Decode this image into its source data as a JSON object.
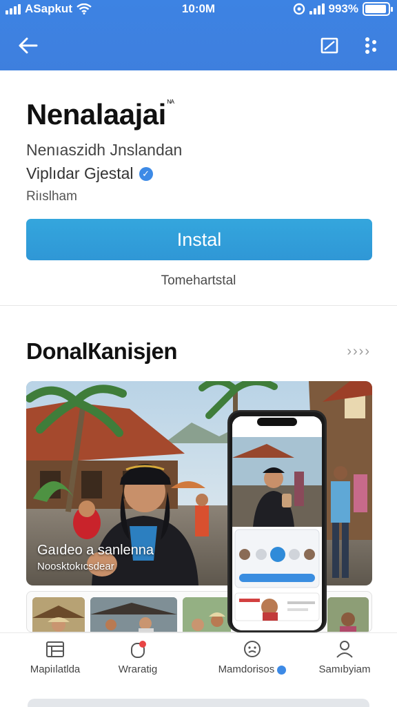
{
  "status_bar": {
    "carrier": "ASapkut",
    "time": "10:0M",
    "battery_text": "993%",
    "battery_level": 0.93
  },
  "app_bar": {
    "back_icon": "back-arrow-icon",
    "screen_icon": "screen-icon",
    "more_icon": "more-dots-icon"
  },
  "app": {
    "name": "Nenalaajai",
    "name_superscript": "ᴺᴬ",
    "subtitle": "Nenıaszidh Jnslandan",
    "developer": "Viplıdar Gjestal",
    "category": "Riıslham",
    "install_label": "Instal",
    "install_note": "Tomehartstal"
  },
  "section": {
    "title": "DonalКanisjen",
    "more": "››››"
  },
  "screenshot": {
    "caption": "Gaıdeo a sanlenna",
    "subcaption": "Noosktokıcsdear"
  },
  "bottom_nav": [
    {
      "label": "Mapiılatlda",
      "icon": "store-icon"
    },
    {
      "label": "Wraratig",
      "icon": "notification-icon"
    },
    {
      "label": "Mamdorisos",
      "icon": "face-icon"
    },
    {
      "label": "Samıbyiam",
      "icon": "profile-icon"
    }
  ],
  "colors": {
    "app_bar": "#3d83e3",
    "install_button": "#34a6dd",
    "verified": "#3d8ae6",
    "notification_dot": "#e84545"
  }
}
